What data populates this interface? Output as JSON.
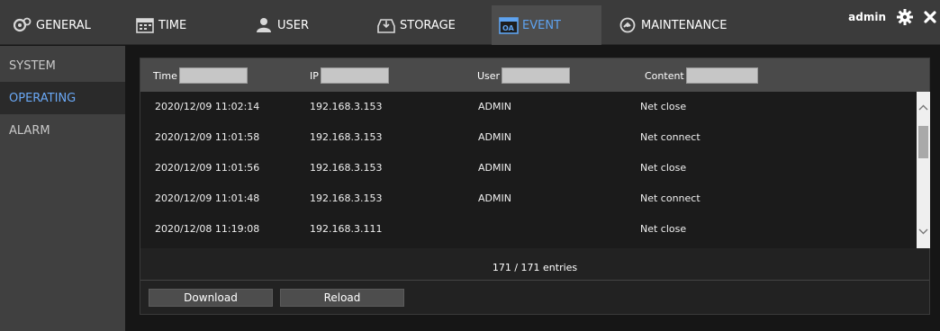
{
  "nav": {
    "tabs": [
      {
        "label": "GENERAL",
        "icon": "general-icon"
      },
      {
        "label": "TIME",
        "icon": "calendar-icon"
      },
      {
        "label": "USER",
        "icon": "user-icon"
      },
      {
        "label": "STORAGE",
        "icon": "storage-icon"
      },
      {
        "label": "EVENT",
        "icon": "event-icon",
        "active": true
      },
      {
        "label": "MAINTENANCE",
        "icon": "maintenance-icon"
      }
    ],
    "user": "admin",
    "accent": "#5ea3f0"
  },
  "sidebar": {
    "items": [
      {
        "label": "SYSTEM"
      },
      {
        "label": "OPERATING",
        "active": true
      },
      {
        "label": "ALARM"
      }
    ]
  },
  "table": {
    "columns": [
      "Time",
      "IP",
      "User",
      "Content"
    ],
    "rows": [
      {
        "time": "2020/12/09  11:02:14",
        "ip": "192.168.3.153",
        "user": "ADMIN",
        "content": "Net close"
      },
      {
        "time": "2020/12/09  11:01:58",
        "ip": "192.168.3.153",
        "user": "ADMIN",
        "content": "Net connect"
      },
      {
        "time": "2020/12/09  11:01:56",
        "ip": "192.168.3.153",
        "user": "ADMIN",
        "content": "Net close"
      },
      {
        "time": "2020/12/09  11:01:48",
        "ip": "192.168.3.153",
        "user": "ADMIN",
        "content": "Net connect"
      },
      {
        "time": "2020/12/08  11:19:08",
        "ip": "192.168.3.111",
        "user": "",
        "content": "Net close"
      }
    ],
    "entries": "171 / 171 entries"
  },
  "buttons": {
    "download": "Download",
    "reload": "Reload"
  }
}
